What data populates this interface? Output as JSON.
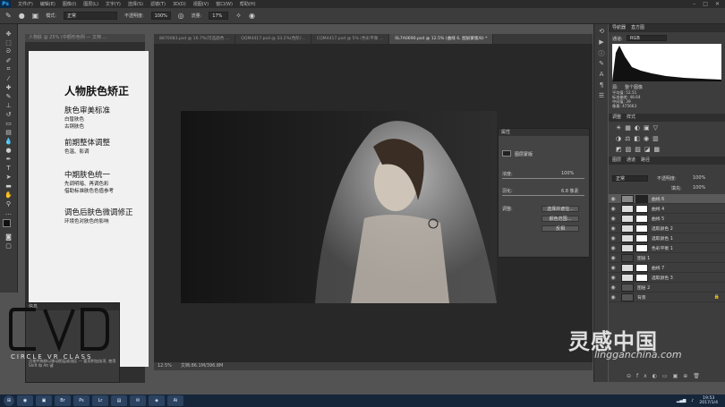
{
  "app": {
    "logo": "Ps"
  },
  "menu": [
    "文件(F)",
    "编辑(E)",
    "图像(I)",
    "图层(L)",
    "文字(Y)",
    "选择(S)",
    "滤镜(T)",
    "3D(D)",
    "视图(V)",
    "窗口(W)",
    "帮助(H)"
  ],
  "options": {
    "mode_label": "模式:",
    "mode_value": "正常",
    "opacity_label": "不透明度:",
    "opacity_value": "100%",
    "flow_label": "流量:",
    "flow_value": "17%"
  },
  "doc_back": {
    "tab": "人物肤 @ 25% (中额形色例 — 文档 ...",
    "title": "人物肤色矫正",
    "sections": [
      {
        "heading": "肤色审美标准",
        "lines": [
          "白皙肤色",
          "古铜肤色"
        ]
      },
      {
        "heading": "前期整体调整",
        "lines": [
          "色温、影调"
        ]
      },
      {
        "heading": "中期肤色统一",
        "lines": [
          "先调明暗、再调色彩",
          "借助标准肤色色值参考"
        ]
      },
      {
        "heading": "调色后肤色微调修正",
        "lines": [
          "环境色对肤色的影响"
        ]
      }
    ]
  },
  "tabs": [
    {
      "label": "8870083.psd @ 16.7%(可选颜色 ...",
      "active": false
    },
    {
      "label": "QQM4417.psd @ 33.2%(色阶/...",
      "active": false
    },
    {
      "label": "CQM4417.psd @ 5% (色彩平衡 ...",
      "active": false
    },
    {
      "label": "0L7A0690.psd @ 12.5% (曲线 6, 图层蒙版/8) *",
      "active": true
    }
  ],
  "doc_title": "0L7A0690.psd @ 12.5% (曲线 6, 图层蒙版/8) *",
  "status": {
    "zoom": "12.5%",
    "doc": "文档:86.1M/396.8M"
  },
  "properties": {
    "tab1": "属性",
    "section": "图层蒙版",
    "density_label": "浓度:",
    "density_value": "100%",
    "feather_label": "羽化:",
    "feather_value": "6.8 像素",
    "adjust_label": "调整:",
    "btn_select": "选择并遮住...",
    "btn_range": "颜色范围...",
    "btn_invert": "反相"
  },
  "history": {
    "title": "信息",
    "footer": "文档: 86.1M/396.8M",
    "hint": "点按并拖移以移动图层或选区 — 要用附加选项, 使用 Shift 和 Alt 键"
  },
  "right": {
    "nav_tabs": [
      "导航器",
      "直方图"
    ],
    "channel_label": "通道:",
    "channel_value": "RGB",
    "source_label": "源:",
    "source_value": "整个图像",
    "stats": [
      "平均值: 52.51",
      "标准偏差: 48.64",
      "中间值: 39",
      "像素: 475663"
    ],
    "adj_tabs": [
      "调整",
      "样式"
    ],
    "layer_tabs": [
      "图层",
      "通道",
      "路径"
    ],
    "blend": "正常",
    "opacity_label": "不透明度:",
    "opacity_value": "100%",
    "fill_label": "填充:",
    "fill_value": "100%",
    "layers": [
      "曲线 6",
      "曲线 4",
      "曲线 5",
      "选取颜色 2",
      "选取颜色 1",
      "色彩平衡 1",
      "图层 1",
      "曲线 7",
      "选取颜色 3",
      "图层 2",
      "背景"
    ]
  },
  "watermark": {
    "cn": "灵感中国",
    "en": "lingganchina.com",
    "cvc": "CIRCLE VR CLASS"
  },
  "tray": {
    "time": "19:53",
    "date": "2017/1/4"
  }
}
